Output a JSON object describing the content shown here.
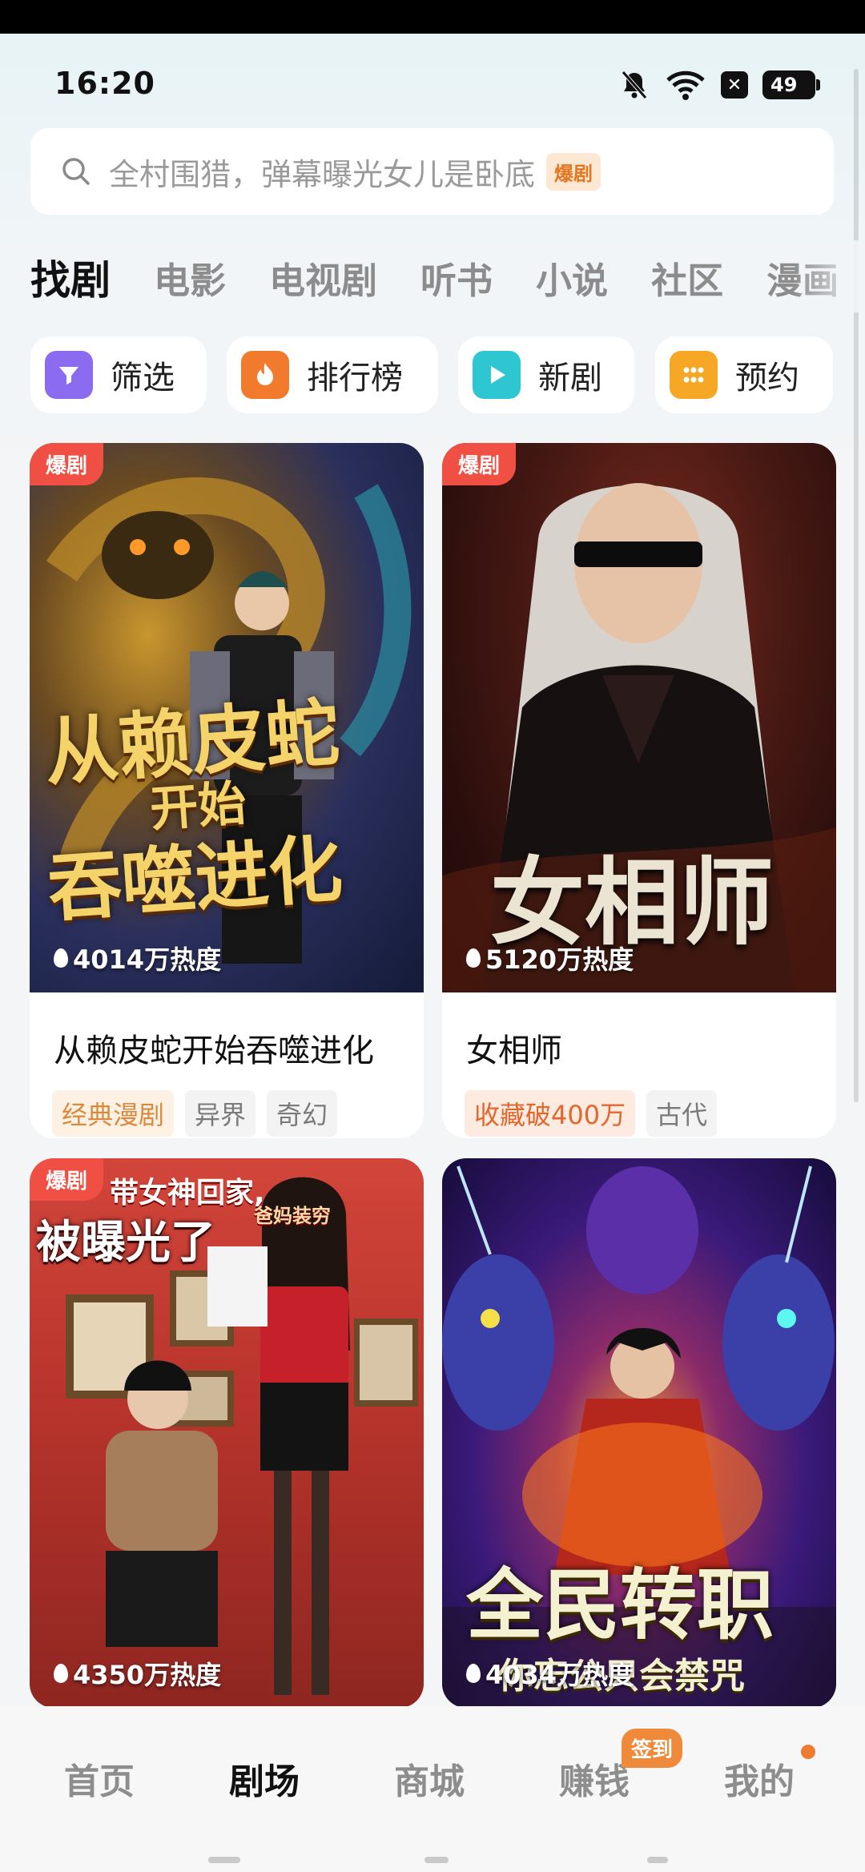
{
  "status_bar": {
    "time": "16:20",
    "battery": "49"
  },
  "search": {
    "placeholder": "全村围猎，弹幕曝光女儿是卧底",
    "tag": "爆剧"
  },
  "tabs": [
    "找剧",
    "电影",
    "电视剧",
    "听书",
    "小说",
    "社区",
    "漫画"
  ],
  "quick_actions": [
    {
      "label": "筛选",
      "color": "#8b6cf0",
      "icon": "filter-icon"
    },
    {
      "label": "排行榜",
      "color": "#f27a2d",
      "icon": "flame-icon"
    },
    {
      "label": "新剧",
      "color": "#2ec6d1",
      "icon": "play-icon"
    },
    {
      "label": "预约",
      "color": "#f6a726",
      "icon": "grid-icon"
    }
  ],
  "cards": [
    {
      "badge": "爆剧",
      "heat": "4014万热度",
      "title": "从赖皮蛇开始吞噬进化",
      "poster_text": [
        "从赖皮蛇",
        "开始",
        "吞噬进化"
      ],
      "tags": [
        "经典漫剧",
        "异界",
        "奇幻"
      ]
    },
    {
      "badge": "爆剧",
      "heat": "5120万热度",
      "title": "女相师",
      "poster_text": [
        "女相师"
      ],
      "tags": [
        "收藏破400万",
        "古代"
      ]
    },
    {
      "badge": "爆剧",
      "heat": "4350万热度",
      "poster_text": [
        "带女神回家,",
        "爸妈装穷",
        "被曝光了"
      ]
    },
    {
      "heat": "4034万热度",
      "poster_text": [
        "全民转职",
        "你忘公只会禁咒"
      ]
    }
  ],
  "bottom_nav": [
    "首页",
    "剧场",
    "商城",
    "赚钱",
    "我的"
  ],
  "signin_badge": "签到",
  "colors": {
    "accent": "#ef8a3a",
    "badge": "#f04f44"
  }
}
